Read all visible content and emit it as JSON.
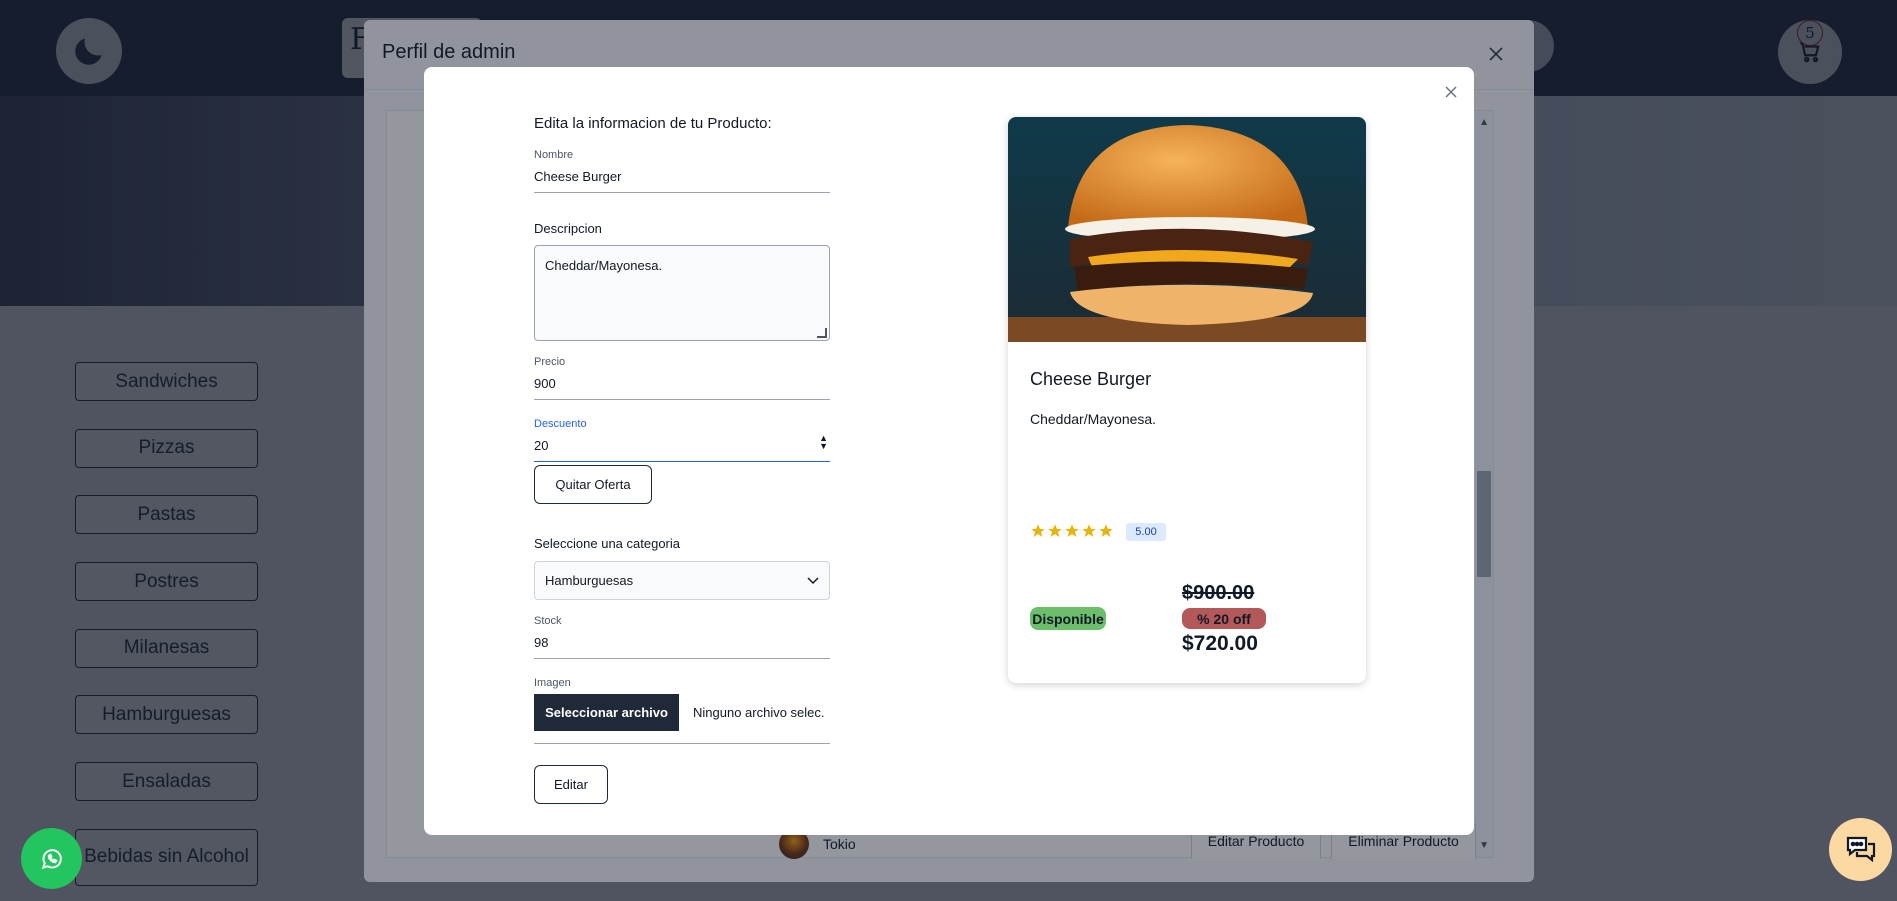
{
  "background": {
    "search_text": "F",
    "cart_count": "5",
    "categories": [
      "Sandwiches",
      "Pizzas",
      "Pastas",
      "Postres",
      "Milanesas",
      "Hamburguesas",
      "Ensaladas",
      "Bebidas sin Alcohol"
    ]
  },
  "admin_modal": {
    "title": "Perfil de admin",
    "row": {
      "name": "Tokio",
      "edit_button": "Editar Producto",
      "delete_button": "Eliminar Producto"
    }
  },
  "edit_form": {
    "heading": "Edita la informacion de tu Producto:",
    "name_label": "Nombre",
    "name_value": "Cheese Burger",
    "description_label": "Descripcion",
    "description_value": "Cheddar/Mayonesa.",
    "price_label": "Precio",
    "price_value": "900",
    "discount_label": "Descuento",
    "discount_value": "20",
    "remove_offer_button": "Quitar Oferta",
    "category_label": "Seleccione una categoria",
    "category_value": "Hamburguesas",
    "stock_label": "Stock",
    "stock_value": "98",
    "image_label": "Imagen",
    "file_button": "Seleccionar archivo",
    "file_status": "Ninguno archivo selec.",
    "submit_button": "Editar"
  },
  "product_card": {
    "title": "Cheese Burger",
    "description": "Cheddar/Mayonesa.",
    "rating_value": 5,
    "rating_label": "5.00",
    "availability": "Disponible",
    "original_price": "$900.00",
    "discount_badge": "% 20 off",
    "final_price": "$720.00"
  },
  "colors": {
    "topbar": "#1f2a44",
    "available_badge": "#6bbf6b",
    "discount_badge": "#b45959",
    "star": "#eab308",
    "whatsapp": "#22c55e",
    "chat": "#fcd9a3",
    "file_button": "#1f2937"
  }
}
